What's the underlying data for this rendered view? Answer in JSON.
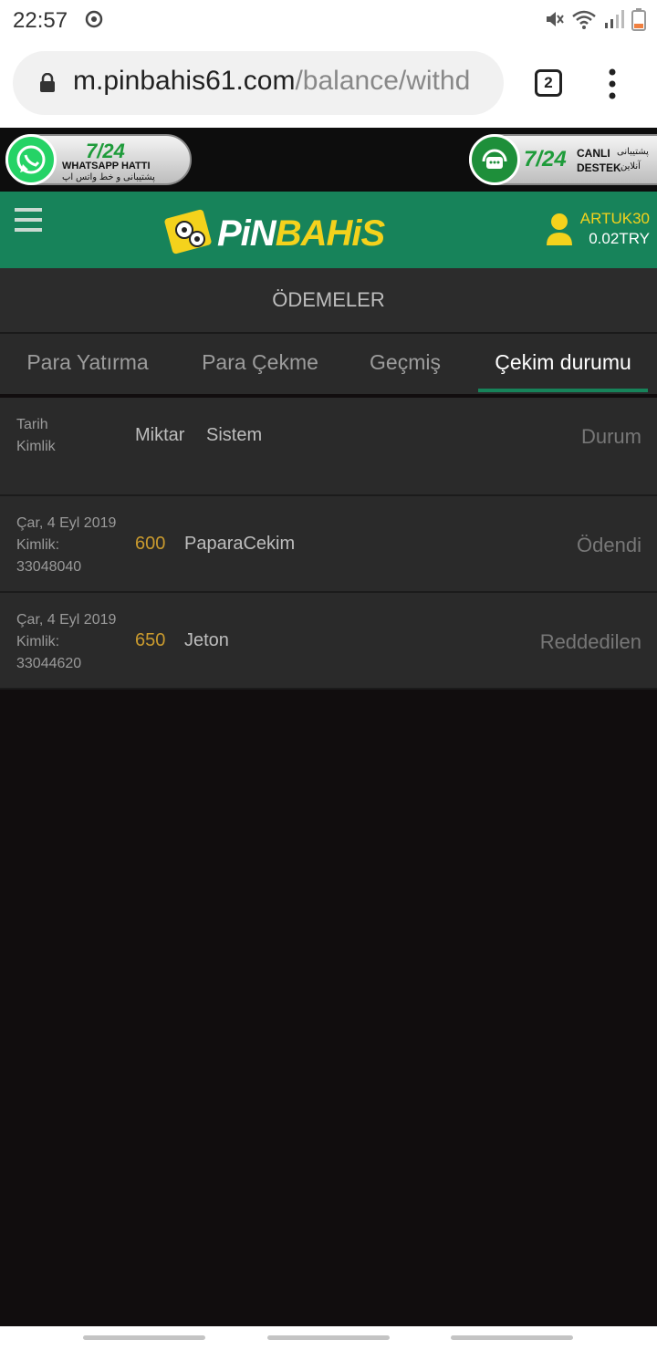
{
  "status_bar": {
    "time": "22:57",
    "icons": [
      "sync-icon",
      "mute-icon",
      "wifi-icon",
      "signal-icon",
      "battery-icon"
    ]
  },
  "browser": {
    "url_host": "m.pinbahis61.com",
    "url_path": "/balance/withd",
    "tab_count": "2",
    "icons": [
      "lock-icon",
      "tabs-icon",
      "more-icon"
    ]
  },
  "promo": {
    "whatsapp": {
      "number": "7/24",
      "title": "WHATSAPP HATTI",
      "subtitle": "پشتیبانی و خط واتس اپ"
    },
    "live_support": {
      "number": "7/24",
      "line1": "CANLI",
      "line2": "DESTEK",
      "fa1": "پشتیبانی",
      "fa2": "آنلاین"
    }
  },
  "header": {
    "brand_part1": "PiN",
    "brand_part2": "BAHiS",
    "username": "ARTUK30",
    "balance": "0.02TRY",
    "colors": {
      "green": "#17835a",
      "yellow": "#f4d21c"
    }
  },
  "page": {
    "title": "ÖDEMELER",
    "tabs": [
      {
        "label": "Para Yatırma",
        "active": false
      },
      {
        "label": "Para Çekme",
        "active": false
      },
      {
        "label": "Geçmiş",
        "active": false
      },
      {
        "label": "Çekim durumu",
        "active": true
      }
    ]
  },
  "table": {
    "headers": {
      "date": "Tarih",
      "id": "Kimlik",
      "amount": "Miktar",
      "system": "Sistem",
      "status": "Durum"
    },
    "rows": [
      {
        "date": "Çar, 4 Eyl 2019",
        "id_label": "Kimlik:",
        "id": "33048040",
        "amount": "600",
        "system": "PaparaCekim",
        "status": "Ödendi"
      },
      {
        "date": "Çar, 4 Eyl 2019",
        "id_label": "Kimlik:",
        "id": "33044620",
        "amount": "650",
        "system": "Jeton",
        "status": "Reddedilen"
      }
    ]
  }
}
